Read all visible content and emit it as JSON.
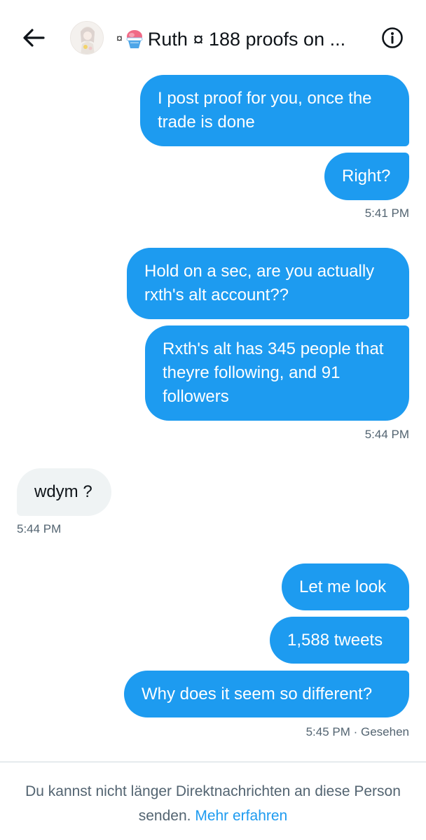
{
  "header": {
    "title_prefix": "¤",
    "title_text": "Ruth ¤ 188 proofs on ...",
    "back_icon": "arrow-left-icon",
    "info_icon": "info-circle-icon"
  },
  "messages": [
    {
      "text": "I post proof for you, once the trade is done"
    },
    {
      "text": "Right?"
    },
    {
      "text": "5:41 PM"
    },
    {
      "text": "Hold on a sec, are you actually rxth's alt account??"
    },
    {
      "text": "Rxth's alt has 345 people that theyre following, and 91 followers"
    },
    {
      "text": "5:44 PM"
    },
    {
      "text": "wdym ?"
    },
    {
      "text": "5:44 PM"
    },
    {
      "text": "Let me look"
    },
    {
      "text": "1,588 tweets"
    },
    {
      "text": "Why does it seem so different?"
    },
    {
      "text": "5:45 PM · Gesehen"
    }
  ],
  "footer": {
    "notice": "Du kannst nicht länger Direktnachrichten an diese Person senden.",
    "learn_more": "Mehr erfahren"
  },
  "colors": {
    "accent": "#1d9bf0",
    "received_bubble": "#eff3f4",
    "meta_text": "#536471"
  }
}
